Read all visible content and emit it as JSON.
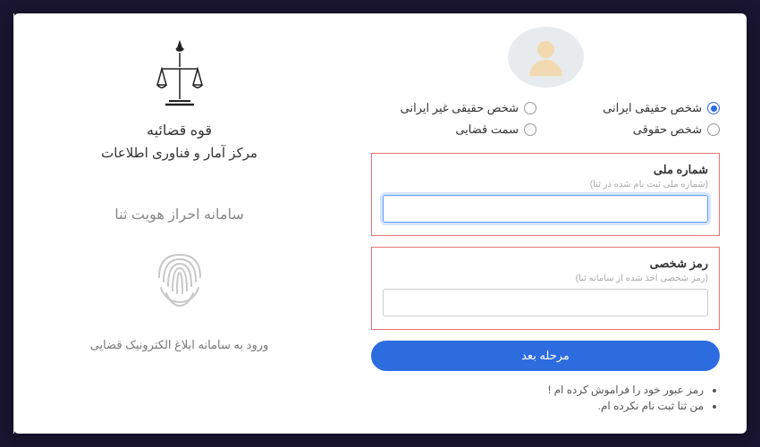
{
  "brand": {
    "title": "قوه قضائیه",
    "subtitle": "مرکز آمار و فناوری اطلاعات",
    "system": "سامانه احراز هویت ثنا",
    "portal_link": "ورود به سامانه ابلاغ الکترونیک قضایی"
  },
  "person_types": {
    "iranian": "شخص حقیقی ایرانی",
    "foreign": "شخص حقیقی غیر ایرانی",
    "legal": "شخص حقوقی",
    "judicial": "سمت قضایی",
    "selected": "iranian"
  },
  "fields": {
    "national_id": {
      "label": "شماره ملی",
      "hint": "(شماره ملی ثبت نام شده در ثنا)",
      "value": ""
    },
    "password": {
      "label": "رمز شخصی",
      "hint": "(رمز شخصی اخذ شده از سامانه ثنا)",
      "value": ""
    }
  },
  "buttons": {
    "next": "مرحله بعد"
  },
  "links": {
    "forgot": "رمز عبور خود را فراموش کرده ام !",
    "not_registered": "من ثنا ثبت نام نکرده ام."
  }
}
